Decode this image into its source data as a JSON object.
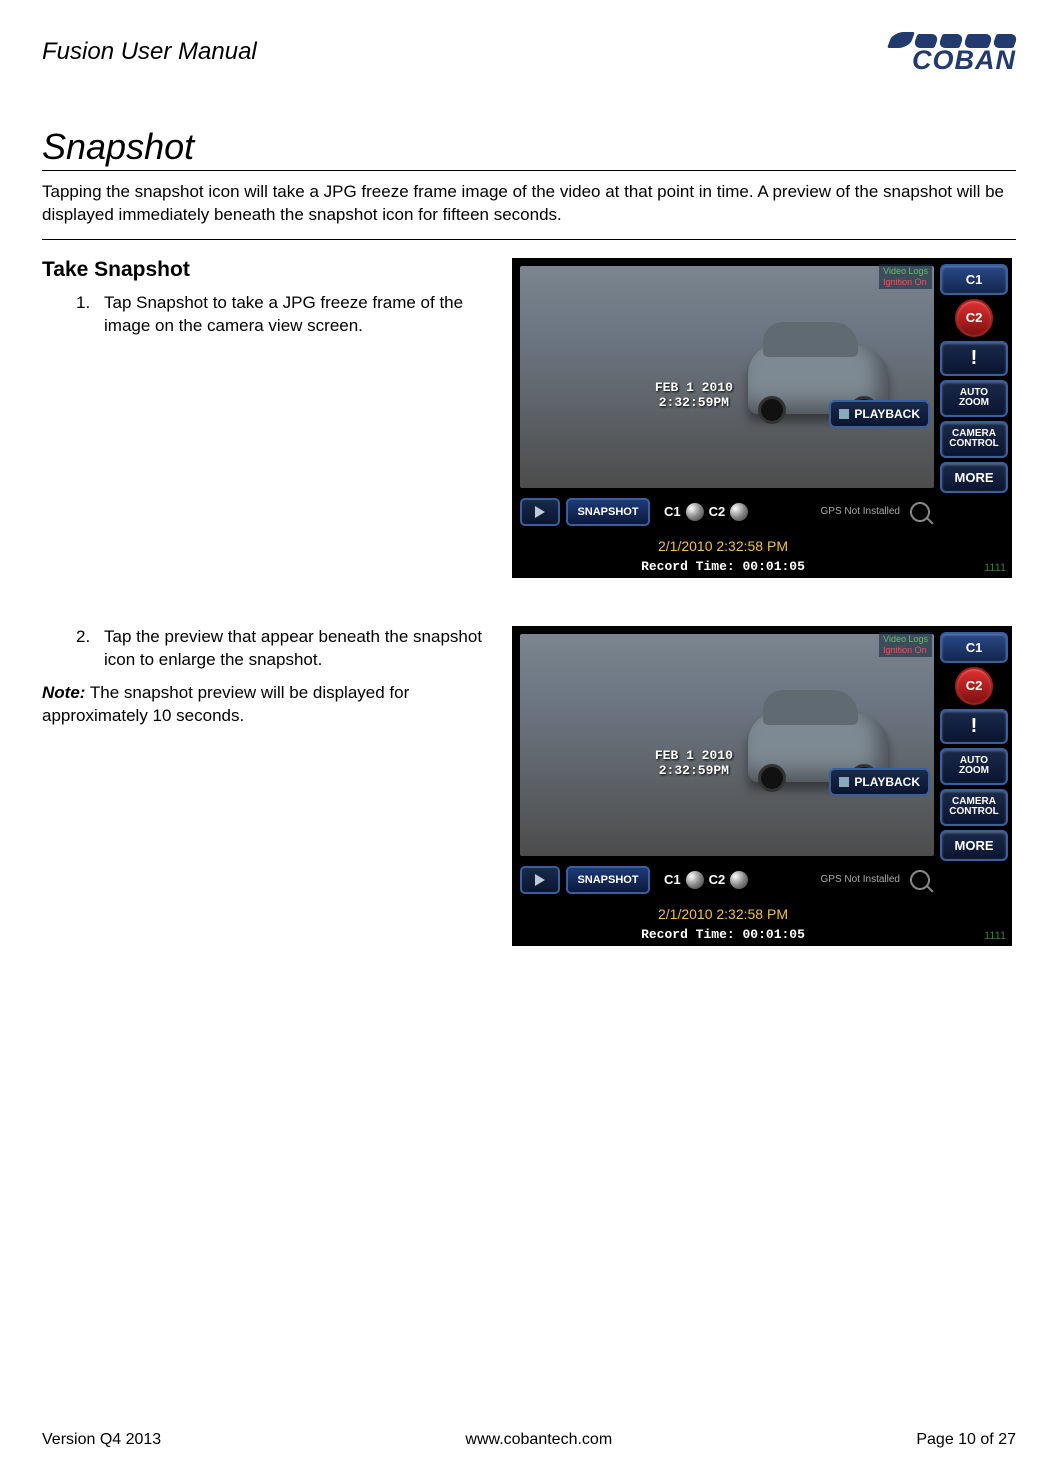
{
  "header": {
    "doc_title": "Fusion User Manual",
    "logo_text": "COBAN"
  },
  "section": {
    "title": "Snapshot",
    "intro": "Tapping the snapshot icon will take a JPG freeze frame image of the video at that point in time. A preview of the snapshot will be displayed immediately beneath the snapshot icon for fifteen seconds.",
    "sub_title": "Take Snapshot",
    "steps": [
      {
        "num": "1.",
        "text": "Tap Snapshot to take a JPG freeze frame of the image on the camera view screen."
      },
      {
        "num": "2.",
        "text": "Tap the preview that appear beneath the snapshot icon to enlarge the snapshot."
      }
    ],
    "note_label": "Note:",
    "note_text": " The snapshot preview will be displayed for approximately 10 seconds."
  },
  "screenshot": {
    "status_line1": "Video Logs",
    "status_line2": "Ignition On",
    "overlay_date1": "FEB   1 2010",
    "overlay_date2": "2:32:59PM",
    "btn_c1": "C1",
    "btn_c2": "C2",
    "btn_bang": "!",
    "btn_auto": "AUTO ZOOM",
    "btn_camera": "CAMERA CONTROL",
    "btn_more": "MORE",
    "btn_playback": "PLAYBACK",
    "btn_snapshot": "SNAPSHOT",
    "cam1": "C1",
    "cam2": "C2",
    "gps": "GPS Not Installed",
    "datetime": "2/1/2010 2:32:58 PM",
    "record": "Record Time: 00:01:05",
    "usernum": "1111"
  },
  "footer": {
    "version": "Version Q4 2013",
    "url": "www.cobantech.com",
    "page": "Page 10 of 27"
  }
}
